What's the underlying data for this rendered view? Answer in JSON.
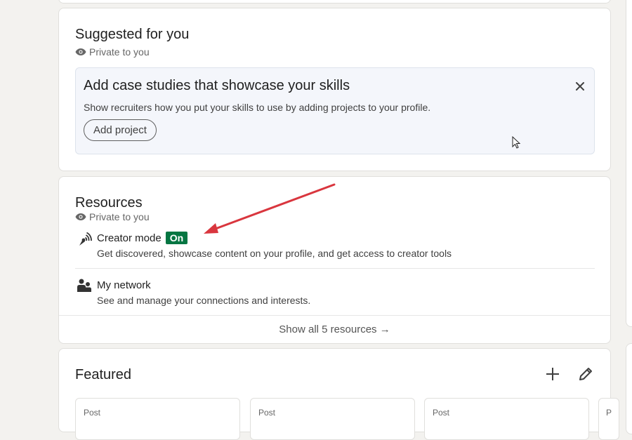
{
  "suggested": {
    "title": "Suggested for you",
    "privacy": "Private to you",
    "card": {
      "heading": "Add case studies that showcase your skills",
      "description": "Show recruiters how you put your skills to use by adding projects to your profile.",
      "button_label": "Add project",
      "close_icon": "close-icon"
    }
  },
  "resources": {
    "title": "Resources",
    "privacy": "Private to you",
    "items": [
      {
        "icon": "broadcast-icon",
        "title": "Creator mode",
        "badge": "On",
        "description": "Get discovered, showcase content on your profile, and get access to creator tools"
      },
      {
        "icon": "people-icon",
        "title": "My network",
        "description": "See and manage your connections and interests."
      }
    ],
    "show_all": "Show all 5 resources →"
  },
  "featured": {
    "title": "Featured",
    "add_icon": "plus-icon",
    "edit_icon": "pencil-icon",
    "posts": [
      "Post",
      "Post",
      "Post",
      "P"
    ]
  },
  "colors": {
    "badge_green": "#057642",
    "annotation_red": "#d9363e",
    "page_bg": "#f3f2ef"
  }
}
